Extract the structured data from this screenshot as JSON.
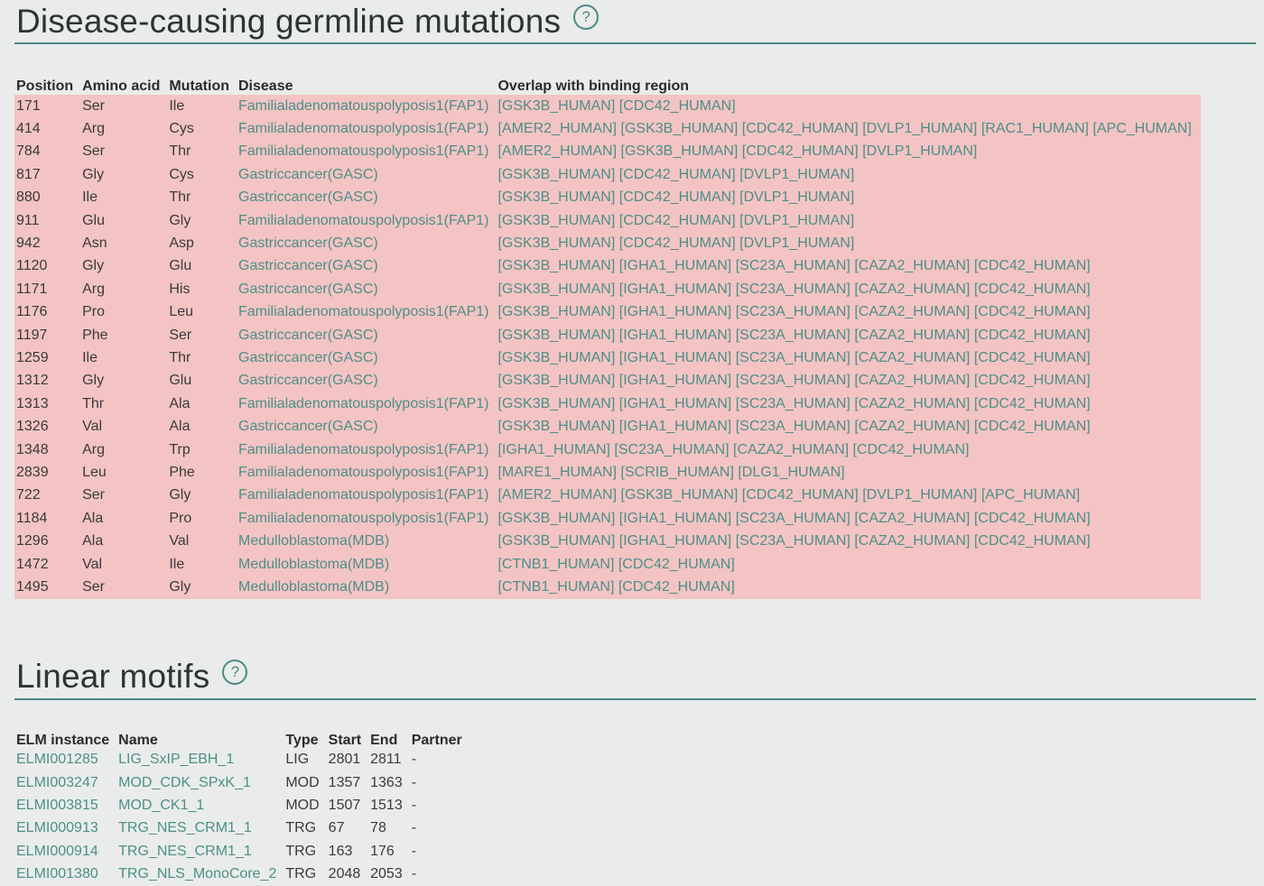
{
  "mutations": {
    "title": "Disease-causing germline mutations",
    "help": "?",
    "headers": [
      "Position",
      "Amino acid",
      "Mutation",
      "Disease",
      "Overlap with binding region"
    ],
    "rows": [
      {
        "pos": "171",
        "aa": "Ser",
        "mut": "Ile",
        "disease": "Familialadenomatouspolyposis1(FAP1)",
        "overlap": [
          "GSK3B_HUMAN",
          "CDC42_HUMAN"
        ]
      },
      {
        "pos": "414",
        "aa": "Arg",
        "mut": "Cys",
        "disease": "Familialadenomatouspolyposis1(FAP1)",
        "overlap": [
          "AMER2_HUMAN",
          "GSK3B_HUMAN",
          "CDC42_HUMAN",
          "DVLP1_HUMAN",
          "RAC1_HUMAN",
          "APC_HUMAN"
        ]
      },
      {
        "pos": "784",
        "aa": "Ser",
        "mut": "Thr",
        "disease": "Familialadenomatouspolyposis1(FAP1)",
        "overlap": [
          "AMER2_HUMAN",
          "GSK3B_HUMAN",
          "CDC42_HUMAN",
          "DVLP1_HUMAN"
        ]
      },
      {
        "pos": "817",
        "aa": "Gly",
        "mut": "Cys",
        "disease": "Gastriccancer(GASC)",
        "overlap": [
          "GSK3B_HUMAN",
          "CDC42_HUMAN",
          "DVLP1_HUMAN"
        ]
      },
      {
        "pos": "880",
        "aa": "Ile",
        "mut": "Thr",
        "disease": "Gastriccancer(GASC)",
        "overlap": [
          "GSK3B_HUMAN",
          "CDC42_HUMAN",
          "DVLP1_HUMAN"
        ]
      },
      {
        "pos": "911",
        "aa": "Glu",
        "mut": "Gly",
        "disease": "Familialadenomatouspolyposis1(FAP1)",
        "overlap": [
          "GSK3B_HUMAN",
          "CDC42_HUMAN",
          "DVLP1_HUMAN"
        ]
      },
      {
        "pos": "942",
        "aa": "Asn",
        "mut": "Asp",
        "disease": "Gastriccancer(GASC)",
        "overlap": [
          "GSK3B_HUMAN",
          "CDC42_HUMAN",
          "DVLP1_HUMAN"
        ]
      },
      {
        "pos": "1120",
        "aa": "Gly",
        "mut": "Glu",
        "disease": "Gastriccancer(GASC)",
        "overlap": [
          "GSK3B_HUMAN",
          "IGHA1_HUMAN",
          "SC23A_HUMAN",
          "CAZA2_HUMAN",
          "CDC42_HUMAN"
        ]
      },
      {
        "pos": "1171",
        "aa": "Arg",
        "mut": "His",
        "disease": "Gastriccancer(GASC)",
        "overlap": [
          "GSK3B_HUMAN",
          "IGHA1_HUMAN",
          "SC23A_HUMAN",
          "CAZA2_HUMAN",
          "CDC42_HUMAN"
        ]
      },
      {
        "pos": "1176",
        "aa": "Pro",
        "mut": "Leu",
        "disease": "Familialadenomatouspolyposis1(FAP1)",
        "overlap": [
          "GSK3B_HUMAN",
          "IGHA1_HUMAN",
          "SC23A_HUMAN",
          "CAZA2_HUMAN",
          "CDC42_HUMAN"
        ]
      },
      {
        "pos": "1197",
        "aa": "Phe",
        "mut": "Ser",
        "disease": "Gastriccancer(GASC)",
        "overlap": [
          "GSK3B_HUMAN",
          "IGHA1_HUMAN",
          "SC23A_HUMAN",
          "CAZA2_HUMAN",
          "CDC42_HUMAN"
        ]
      },
      {
        "pos": "1259",
        "aa": "Ile",
        "mut": "Thr",
        "disease": "Gastriccancer(GASC)",
        "overlap": [
          "GSK3B_HUMAN",
          "IGHA1_HUMAN",
          "SC23A_HUMAN",
          "CAZA2_HUMAN",
          "CDC42_HUMAN"
        ]
      },
      {
        "pos": "1312",
        "aa": "Gly",
        "mut": "Glu",
        "disease": "Gastriccancer(GASC)",
        "overlap": [
          "GSK3B_HUMAN",
          "IGHA1_HUMAN",
          "SC23A_HUMAN",
          "CAZA2_HUMAN",
          "CDC42_HUMAN"
        ]
      },
      {
        "pos": "1313",
        "aa": "Thr",
        "mut": "Ala",
        "disease": "Familialadenomatouspolyposis1(FAP1)",
        "overlap": [
          "GSK3B_HUMAN",
          "IGHA1_HUMAN",
          "SC23A_HUMAN",
          "CAZA2_HUMAN",
          "CDC42_HUMAN"
        ]
      },
      {
        "pos": "1326",
        "aa": "Val",
        "mut": "Ala",
        "disease": "Gastriccancer(GASC)",
        "overlap": [
          "GSK3B_HUMAN",
          "IGHA1_HUMAN",
          "SC23A_HUMAN",
          "CAZA2_HUMAN",
          "CDC42_HUMAN"
        ]
      },
      {
        "pos": "1348",
        "aa": "Arg",
        "mut": "Trp",
        "disease": "Familialadenomatouspolyposis1(FAP1)",
        "overlap": [
          "IGHA1_HUMAN",
          "SC23A_HUMAN",
          "CAZA2_HUMAN",
          "CDC42_HUMAN"
        ]
      },
      {
        "pos": "2839",
        "aa": "Leu",
        "mut": "Phe",
        "disease": "Familialadenomatouspolyposis1(FAP1)",
        "overlap": [
          "MARE1_HUMAN",
          "SCRIB_HUMAN",
          "DLG1_HUMAN"
        ]
      },
      {
        "pos": "722",
        "aa": "Ser",
        "mut": "Gly",
        "disease": "Familialadenomatouspolyposis1(FAP1)",
        "overlap": [
          "AMER2_HUMAN",
          "GSK3B_HUMAN",
          "CDC42_HUMAN",
          "DVLP1_HUMAN",
          "APC_HUMAN"
        ]
      },
      {
        "pos": "1184",
        "aa": "Ala",
        "mut": "Pro",
        "disease": "Familialadenomatouspolyposis1(FAP1)",
        "overlap": [
          "GSK3B_HUMAN",
          "IGHA1_HUMAN",
          "SC23A_HUMAN",
          "CAZA2_HUMAN",
          "CDC42_HUMAN"
        ]
      },
      {
        "pos": "1296",
        "aa": "Ala",
        "mut": "Val",
        "disease": "Medulloblastoma(MDB)",
        "overlap": [
          "GSK3B_HUMAN",
          "IGHA1_HUMAN",
          "SC23A_HUMAN",
          "CAZA2_HUMAN",
          "CDC42_HUMAN"
        ]
      },
      {
        "pos": "1472",
        "aa": "Val",
        "mut": "Ile",
        "disease": "Medulloblastoma(MDB)",
        "overlap": [
          "CTNB1_HUMAN",
          "CDC42_HUMAN"
        ]
      },
      {
        "pos": "1495",
        "aa": "Ser",
        "mut": "Gly",
        "disease": "Medulloblastoma(MDB)",
        "overlap": [
          "CTNB1_HUMAN",
          "CDC42_HUMAN"
        ]
      }
    ]
  },
  "motifs": {
    "title": "Linear motifs",
    "help": "?",
    "headers": [
      "ELM instance",
      "Name",
      "Type",
      "Start",
      "End",
      "Partner"
    ],
    "rows": [
      {
        "elm": "ELMI001285",
        "name": "LIG_SxIP_EBH_1",
        "type": "LIG",
        "start": "2801",
        "end": "2811",
        "partner": "-"
      },
      {
        "elm": "ELMI003247",
        "name": "MOD_CDK_SPxK_1",
        "type": "MOD",
        "start": "1357",
        "end": "1363",
        "partner": "-"
      },
      {
        "elm": "ELMI003815",
        "name": "MOD_CK1_1",
        "type": "MOD",
        "start": "1507",
        "end": "1513",
        "partner": "-"
      },
      {
        "elm": "ELMI000913",
        "name": "TRG_NES_CRM1_1",
        "type": "TRG",
        "start": "67",
        "end": "78",
        "partner": "-"
      },
      {
        "elm": "ELMI000914",
        "name": "TRG_NES_CRM1_1",
        "type": "TRG",
        "start": "163",
        "end": "176",
        "partner": "-"
      },
      {
        "elm": "ELMI001380",
        "name": "TRG_NLS_MonoCore_2",
        "type": "TRG",
        "start": "2048",
        "end": "2053",
        "partner": "-"
      }
    ]
  },
  "colors": {
    "accent": "#4a8a84",
    "link": "#4d8f88",
    "row_highlight": "#f3c4c3",
    "background": "#e9ecea"
  }
}
